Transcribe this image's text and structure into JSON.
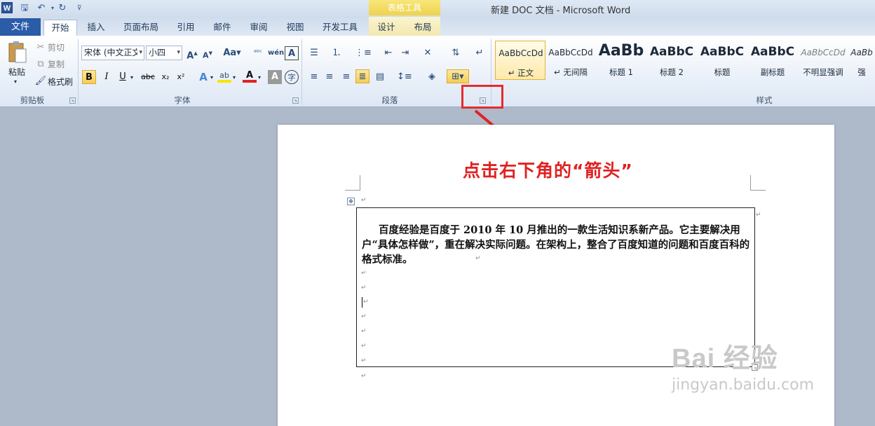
{
  "titlebar": {
    "app_letter": "W",
    "table_tools": "表格工具",
    "window_title": "新建 DOC 文档 - Microsoft Word"
  },
  "tabs": [
    "开始",
    "插入",
    "页面布局",
    "引用",
    "邮件",
    "审阅",
    "视图",
    "开发工具",
    "设计",
    "布局"
  ],
  "file_tab": "文件",
  "clipboard": {
    "paste": "粘贴",
    "cut": "剪切",
    "copy": "复制",
    "format_painter": "格式刷",
    "label": "剪贴板"
  },
  "font": {
    "family": "宋体 (中文正文",
    "size": "小四",
    "label": "字体"
  },
  "paragraph": {
    "label": "段落"
  },
  "styles": {
    "label": "样式",
    "items": [
      {
        "sample": "AaBbCcDd",
        "name": "↵ 正文"
      },
      {
        "sample": "AaBbCcDd",
        "name": "↵ 无间隔"
      },
      {
        "sample": "AaBb",
        "name": "标题 1"
      },
      {
        "sample": "AaBbC",
        "name": "标题 2"
      },
      {
        "sample": "AaBbC",
        "name": "标题"
      },
      {
        "sample": "AaBbC",
        "name": "副标题"
      },
      {
        "sample": "AaBbCcDd",
        "name": "不明显强调"
      },
      {
        "sample": "AaBb",
        "name": "强"
      }
    ]
  },
  "document": {
    "paragraph": "百度经验是百度于 2010 年 10 月推出的一款生活知识系新产品。它主要解决用户“具体怎样做”，重在解决实际问题。在架构上，整合了百度知道的问题和百度百科的格式标准。"
  },
  "annotation": "点击右下角的“箭头”",
  "watermark": {
    "logo": "Bai 经验",
    "url": "jingyan.baidu.com"
  },
  "colors": {
    "accent_red": "#e02222",
    "file_tab": "#2a5ca8",
    "highlight": "#f7cc53"
  }
}
